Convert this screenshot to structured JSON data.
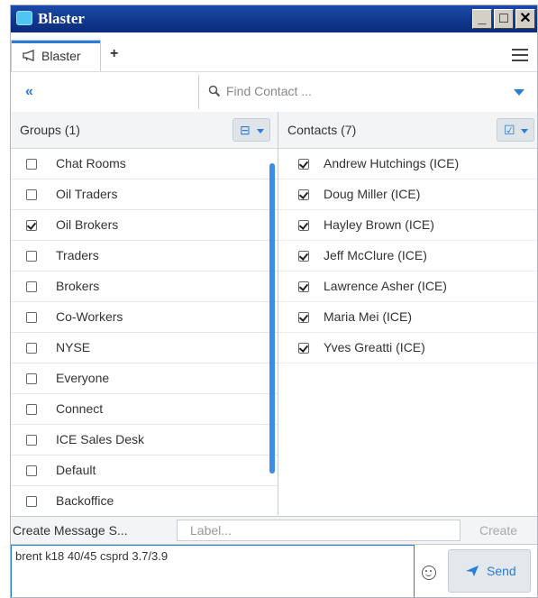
{
  "window": {
    "title": "Blaster"
  },
  "tabs": [
    {
      "label": "Blaster",
      "icon": "megaphone-icon"
    }
  ],
  "tab_add": "+",
  "search": {
    "placeholder": "Find Contact ..."
  },
  "groups": {
    "header": "Groups (1)",
    "items": [
      {
        "label": "Chat Rooms",
        "checked": false
      },
      {
        "label": "Oil Traders",
        "checked": false
      },
      {
        "label": "Oil Brokers",
        "checked": true
      },
      {
        "label": "Traders",
        "checked": false
      },
      {
        "label": "Brokers",
        "checked": false
      },
      {
        "label": "Co-Workers",
        "checked": false
      },
      {
        "label": "NYSE",
        "checked": false
      },
      {
        "label": "Everyone",
        "checked": false
      },
      {
        "label": "Connect",
        "checked": false
      },
      {
        "label": "ICE Sales Desk",
        "checked": false
      },
      {
        "label": "Default",
        "checked": false
      },
      {
        "label": "Backoffice",
        "checked": false
      }
    ]
  },
  "contacts": {
    "header": "Contacts (7)",
    "items": [
      {
        "label": "Andrew Hutchings (ICE)",
        "checked": true
      },
      {
        "label": "Doug Miller (ICE)",
        "checked": true
      },
      {
        "label": "Hayley Brown (ICE)",
        "checked": true
      },
      {
        "label": "Jeff McClure (ICE)",
        "checked": true
      },
      {
        "label": "Lawrence Asher (ICE)",
        "checked": true
      },
      {
        "label": "Maria Mei (ICE)",
        "checked": true
      },
      {
        "label": "Yves Greatti (ICE)",
        "checked": true
      }
    ]
  },
  "create": {
    "label": "Create Message S...",
    "input_placeholder": "Label...",
    "button": "Create"
  },
  "message": {
    "text": "brent k18 40/45 csprd 3.7/3.9"
  },
  "send": {
    "label": "Send"
  },
  "colors": {
    "accent": "#2a7dd9",
    "titlebar": "#0a2a78"
  }
}
